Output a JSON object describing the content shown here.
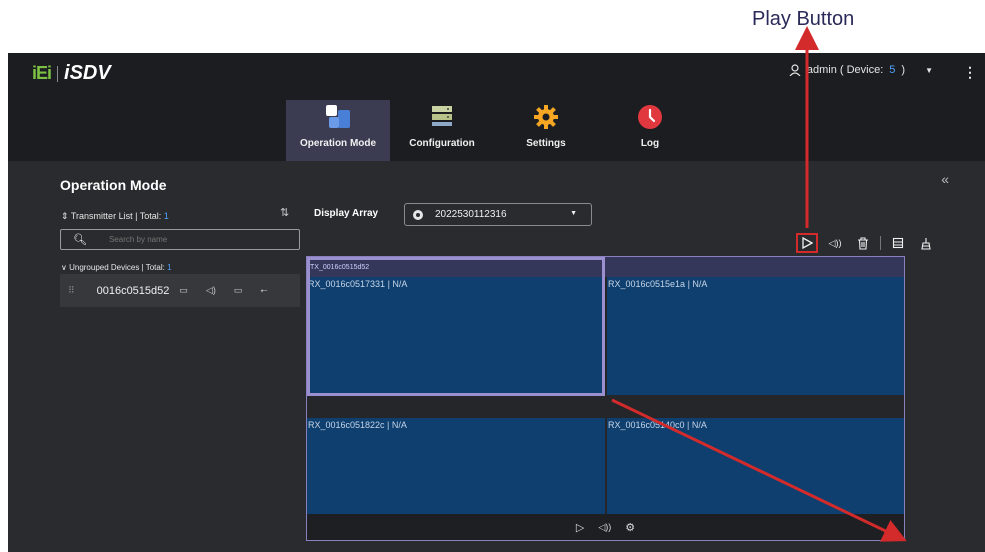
{
  "annotation": {
    "label": "Play Button",
    "color": "#d32b2b"
  },
  "header": {
    "logo_left": "iEi",
    "logo_right": "iSDV",
    "user_label": "admin ( Device: ",
    "user_count": "5",
    "user_suffix": " )"
  },
  "nav": {
    "tabs": [
      {
        "label": "Operation Mode",
        "icon": "operation-mode-icon",
        "active": true
      },
      {
        "label": "Configuration",
        "icon": "configuration-icon",
        "active": false
      },
      {
        "label": "Settings",
        "icon": "settings-gear-icon",
        "active": false
      },
      {
        "label": "Log",
        "icon": "log-clock-icon",
        "active": false
      }
    ]
  },
  "page": {
    "title": "Operation Mode"
  },
  "transmitters": {
    "title": "Transmitter List | Total: ",
    "total": "1",
    "search_placeholder": "Search by name",
    "group_title": "Ungrouped Devices | Total: ",
    "group_total": "1",
    "devices": [
      {
        "name": "0016c0515d52"
      }
    ]
  },
  "display": {
    "label": "Display Array",
    "selected": "2022530112316",
    "tx_name": "TX_0016c0515d52",
    "cells": [
      "RX_0016c0517331 | N/A",
      "RX_0016c0515e1a | N/A",
      "RX_0016c051822c | N/A",
      "RX_0016c05140c0 | N/A"
    ]
  },
  "colors": {
    "accent": "#4fa3ff",
    "cell": "#0e3f6e",
    "selection": "#9a90cf",
    "tx_bar": "#34365a"
  }
}
